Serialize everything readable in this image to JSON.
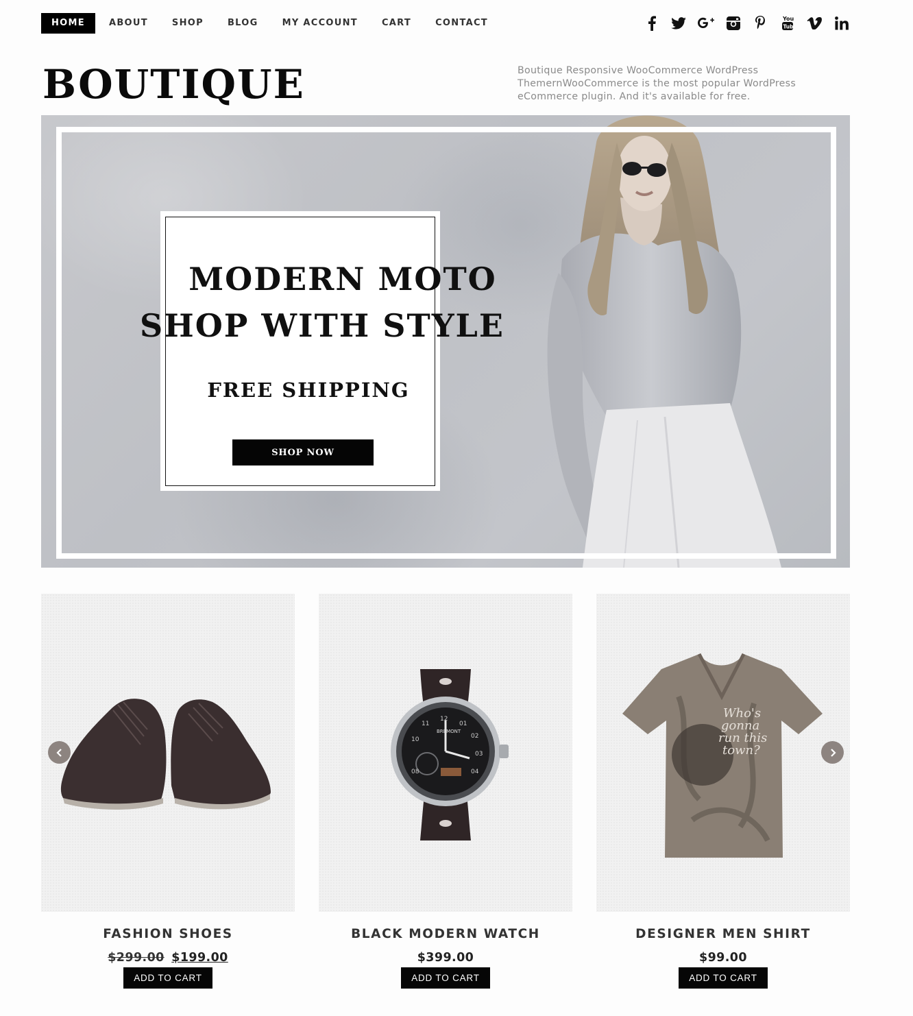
{
  "nav": {
    "items": [
      {
        "label": "HOME",
        "active": true
      },
      {
        "label": "ABOUT"
      },
      {
        "label": "SHOP"
      },
      {
        "label": "BLOG"
      },
      {
        "label": "MY ACCOUNT"
      },
      {
        "label": "CART"
      },
      {
        "label": "CONTACT"
      }
    ]
  },
  "social": {
    "icons": [
      "facebook-icon",
      "twitter-icon",
      "google-plus-icon",
      "instagram-icon",
      "pinterest-icon",
      "youtube-icon",
      "vimeo-icon",
      "linkedin-icon"
    ]
  },
  "header": {
    "logo": "BOUTIQUE",
    "tagline": "Boutique Responsive WooCommerce WordPress ThemernWooCommerce is the most popular WordPress eCommerce plugin. And it's available for free."
  },
  "hero": {
    "headline_line1": "MODERN MOTO",
    "headline_line2": "SHOP WITH STYLE",
    "subheadline": "FREE SHIPPING",
    "cta_label": "SHOP NOW"
  },
  "products": [
    {
      "title": "FASHION SHOES",
      "old_price": "$299.00",
      "price": "$199.00",
      "add_label": "ADD TO CART"
    },
    {
      "title": "BLACK MODERN WATCH",
      "price": "$399.00",
      "add_label": "ADD TO CART"
    },
    {
      "title": "DESIGNER MEN SHIRT",
      "price": "$99.00",
      "add_label": "ADD TO CART"
    }
  ],
  "watch_dial": {
    "brand": "BREMONT",
    "numerals": [
      "10",
      "11",
      "12",
      "01",
      "02",
      "03",
      "04",
      "08"
    ]
  },
  "shirt_print": {
    "text_lines": [
      "Who's",
      "gonna",
      "run this",
      "town?"
    ]
  },
  "colors": {
    "accent": "#000000",
    "arrow": "#8d8480",
    "hero_bg": "#c3c5ca"
  }
}
